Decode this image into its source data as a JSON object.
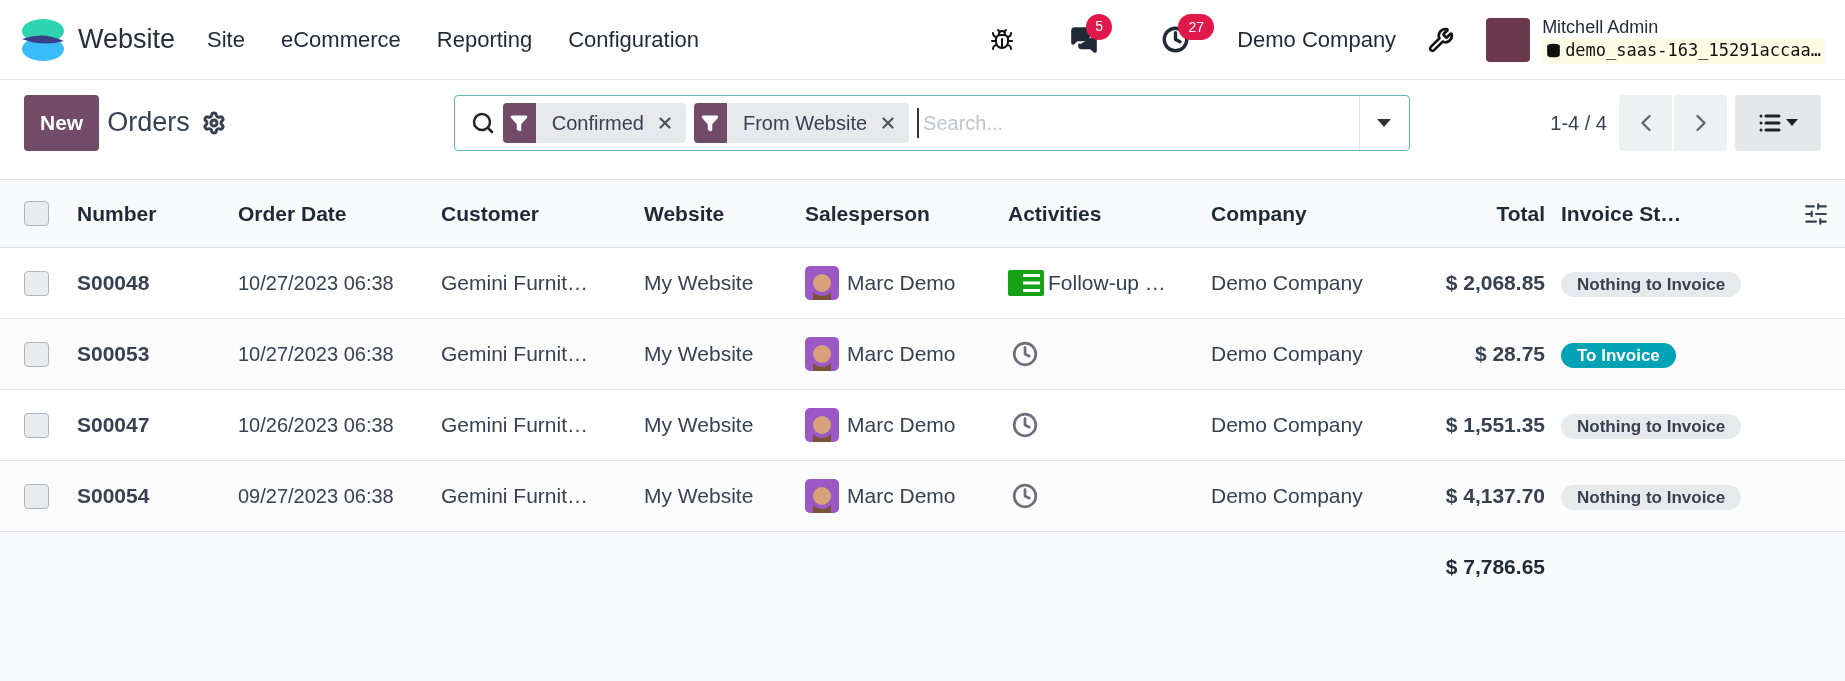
{
  "navbar": {
    "app_name": "Website",
    "menu": [
      "Site",
      "eCommerce",
      "Reporting",
      "Configuration"
    ],
    "messages_count": "5",
    "activities_count": "27",
    "company": "Demo Company",
    "user_name": "Mitchell Admin",
    "database": "demo_saas-163_15291accaa…"
  },
  "control_panel": {
    "new_button": "New",
    "title": "Orders",
    "filters": [
      "Confirmed",
      "From Website"
    ],
    "search_placeholder": "Search...",
    "pager": "1-4 / 4"
  },
  "table": {
    "select_all_checked": false,
    "columns": [
      "Number",
      "Order Date",
      "Customer",
      "Website",
      "Salesperson",
      "Activities",
      "Company",
      "Total",
      "Invoice St…"
    ],
    "rows": [
      {
        "checked": false,
        "number": "S00048",
        "order_date": "10/27/2023 06:38",
        "customer": "Gemini Furnit…",
        "website": "My Website",
        "salesperson": "Marc Demo",
        "activity": {
          "kind": "todo",
          "label": "Follow-up …"
        },
        "company": "Demo Company",
        "total": "$ 2,068.85",
        "invoice_status": {
          "kind": "muted",
          "label": "Nothing to Invoice"
        }
      },
      {
        "checked": false,
        "number": "S00053",
        "order_date": "10/27/2023 06:38",
        "customer": "Gemini Furnit…",
        "website": "My Website",
        "salesperson": "Marc Demo",
        "activity": {
          "kind": "clock"
        },
        "company": "Demo Company",
        "total": "$ 28.75",
        "invoice_status": {
          "kind": "info",
          "label": "To Invoice"
        }
      },
      {
        "checked": false,
        "number": "S00047",
        "order_date": "10/26/2023 06:38",
        "customer": "Gemini Furnit…",
        "website": "My Website",
        "salesperson": "Marc Demo",
        "activity": {
          "kind": "clock"
        },
        "company": "Demo Company",
        "total": "$ 1,551.35",
        "invoice_status": {
          "kind": "muted",
          "label": "Nothing to Invoice"
        }
      },
      {
        "checked": false,
        "number": "S00054",
        "order_date": "09/27/2023 06:38",
        "customer": "Gemini Furnit…",
        "website": "My Website",
        "salesperson": "Marc Demo",
        "activity": {
          "kind": "clock"
        },
        "company": "Demo Company",
        "total": "$ 4,137.70",
        "invoice_status": {
          "kind": "muted",
          "label": "Nothing to Invoice"
        }
      }
    ],
    "sum_total": "$ 7,786.65"
  }
}
